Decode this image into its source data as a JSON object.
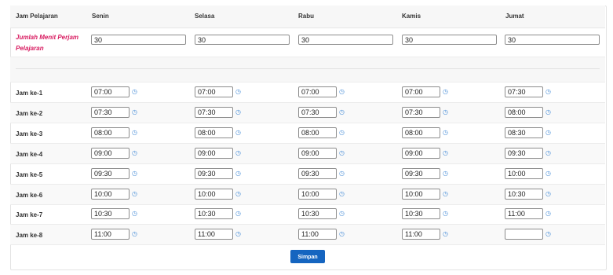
{
  "header": {
    "label_col": "Jam Pelajaran",
    "days": [
      "Senin",
      "Selasa",
      "Rabu",
      "Kamis",
      "Jumat"
    ]
  },
  "minutes": {
    "label": "Jumlah Menit Perjam Pelajaran",
    "values": [
      "30",
      "30",
      "30",
      "30",
      "30"
    ]
  },
  "rows": [
    {
      "label": "Jam ke-1",
      "times": [
        "07:00",
        "07:00",
        "07:00",
        "07:00",
        "07:30"
      ]
    },
    {
      "label": "Jam ke-2",
      "times": [
        "07:30",
        "07:30",
        "07:30",
        "07:30",
        "08:00"
      ]
    },
    {
      "label": "Jam ke-3",
      "times": [
        "08:00",
        "08:00",
        "08:00",
        "08:00",
        "08:30"
      ]
    },
    {
      "label": "Jam ke-4",
      "times": [
        "09:00",
        "09:00",
        "09:00",
        "09:00",
        "09:30"
      ]
    },
    {
      "label": "Jam ke-5",
      "times": [
        "09:30",
        "09:30",
        "09:30",
        "09:30",
        "10:00"
      ]
    },
    {
      "label": "Jam ke-6",
      "times": [
        "10:00",
        "10:00",
        "10:00",
        "10:00",
        "10:30"
      ]
    },
    {
      "label": "Jam ke-7",
      "times": [
        "10:30",
        "10:30",
        "10:30",
        "10:30",
        "11:00"
      ]
    },
    {
      "label": "Jam ke-8",
      "times": [
        "11:00",
        "11:00",
        "11:00",
        "11:00",
        ""
      ]
    }
  ],
  "actions": {
    "save_label": "Simpan"
  },
  "icons": {
    "time_picker": "clock-icon"
  },
  "colors": {
    "accent": "#1565c0",
    "label_highlight": "#d81b60",
    "icon": "#4a8fd8"
  }
}
